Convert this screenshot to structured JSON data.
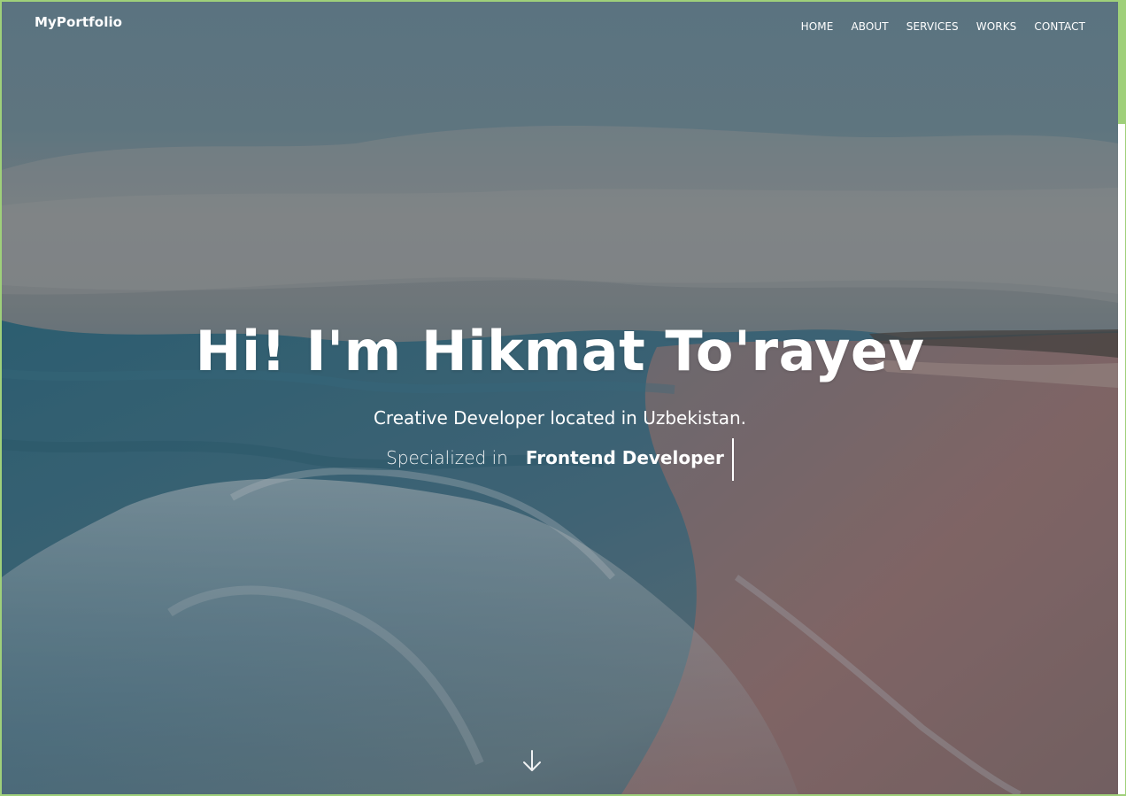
{
  "navbar": {
    "brand": "MyPortfolio",
    "links": [
      {
        "label": "HOME"
      },
      {
        "label": "ABOUT"
      },
      {
        "label": "SERVICES"
      },
      {
        "label": "WORKS"
      },
      {
        "label": "CONTACT"
      }
    ]
  },
  "hero": {
    "title": "Hi! I'm Hikmat To'rayev",
    "subtitle": "Creative Developer located in Uzbekistan.",
    "specialized_label": "Specialized in",
    "specialized_role": "Frontend Developer",
    "scroll_icon": "arrow-down-icon"
  },
  "colors": {
    "text": "#ffffff",
    "page_border": "#9fd07a"
  }
}
